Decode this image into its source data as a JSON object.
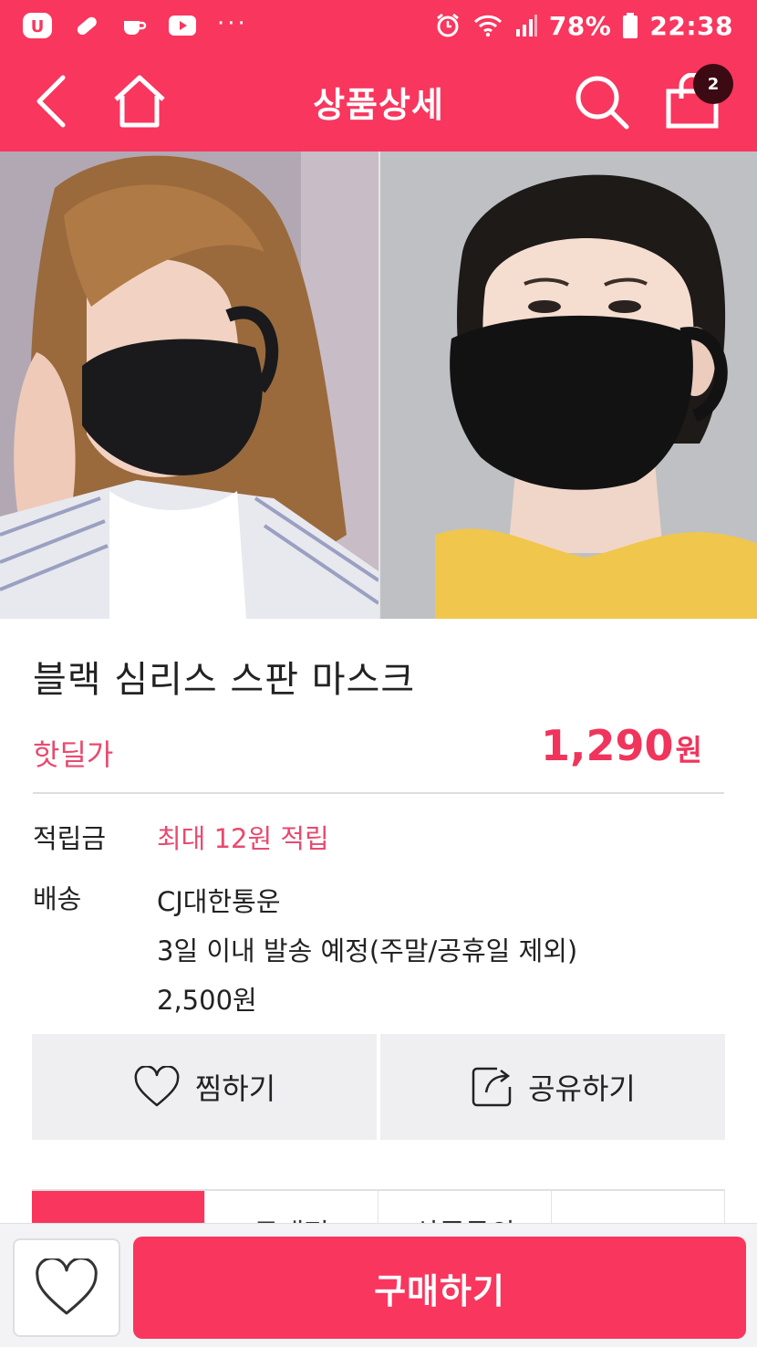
{
  "status_bar": {
    "battery_percent": "78%",
    "time": "22:38",
    "overflow": "···"
  },
  "header": {
    "title": "상품상세",
    "cart_count": "2"
  },
  "product": {
    "title": "블랙 심리스 스판 마스크",
    "price_label": "핫딜가",
    "price": "1,290",
    "price_unit": "원"
  },
  "info": {
    "points_label": "적립금",
    "points_value": "최대 12원 적립",
    "shipping_label": "배송",
    "shipping_carrier": "CJ대한통운",
    "shipping_schedule": "3일 이내 발송 예정(주말/공휴일 제외)",
    "shipping_fee": "2,500원"
  },
  "actions": {
    "wishlist_label": "찜하기",
    "share_label": "공유하기"
  },
  "tabs": [
    {
      "label": ""
    },
    {
      "label": "구매평"
    },
    {
      "label": "상품문의"
    },
    {
      "label": ""
    }
  ],
  "bottom_bar": {
    "buy_label": "구매하기"
  },
  "colors": {
    "brand": "#f8365e",
    "price": "#f0345c",
    "badge": "#3b0a12"
  }
}
